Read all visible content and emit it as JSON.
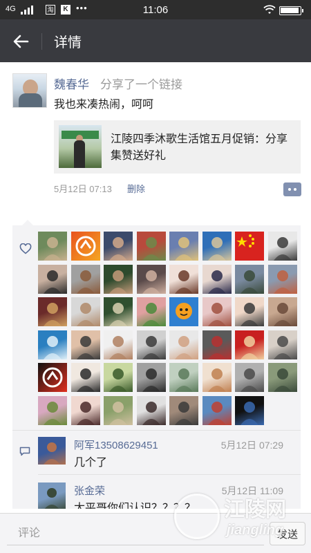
{
  "status_bar": {
    "network": "4G",
    "app_badge_1": "淘",
    "app_badge_2": "K",
    "more": "•••",
    "time": "11:06"
  },
  "header": {
    "title": "详情"
  },
  "post": {
    "author": "魏春华",
    "action": "分享了一个链接",
    "text": "我也来凑热闹，呵呵",
    "link_title": "江陵四季沐歌生活馆五月促销：分享集赞送好礼",
    "timestamp": "5月12日 07:13",
    "delete_label": "删除"
  },
  "likes": {
    "avatars": [
      {
        "icon": "avatar-photo",
        "colors": [
          "#6e8a5c",
          "#c9b18f"
        ]
      },
      {
        "icon": "avatar-logo",
        "colors": [
          "#e8531f",
          "#f5a623"
        ]
      },
      {
        "icon": "avatar-photo",
        "colors": [
          "#3b4a6b",
          "#d3a98a"
        ]
      },
      {
        "icon": "avatar-photo",
        "colors": [
          "#b84a3c",
          "#6c8a4a"
        ]
      },
      {
        "icon": "avatar-photo",
        "colors": [
          "#6a7fb0",
          "#e0c27a"
        ]
      },
      {
        "icon": "avatar-photo",
        "colors": [
          "#2f6fb8",
          "#d9c69a"
        ]
      },
      {
        "icon": "avatar-flag",
        "colors": [
          "#d8231f",
          "#ffde00"
        ]
      },
      {
        "icon": "avatar-photo",
        "colors": [
          "#e8e8e8",
          "#3a3a3a"
        ]
      },
      {
        "icon": "avatar-photo",
        "colors": [
          "#c8b0a0",
          "#2a2a2a"
        ]
      },
      {
        "icon": "avatar-photo",
        "colors": [
          "#a0a0a0",
          "#8a5a3a"
        ]
      },
      {
        "icon": "avatar-photo",
        "colors": [
          "#2d4a2d",
          "#c49a7a"
        ]
      },
      {
        "icon": "avatar-photo",
        "colors": [
          "#5a4a4a",
          "#d0b0a0"
        ]
      },
      {
        "icon": "avatar-photo",
        "colors": [
          "#f0e0d8",
          "#6a3a2a"
        ]
      },
      {
        "icon": "avatar-photo",
        "colors": [
          "#e8d8d0",
          "#2a2a4a"
        ]
      },
      {
        "icon": "avatar-photo",
        "colors": [
          "#7a8aa0",
          "#3a4a3a"
        ]
      },
      {
        "icon": "avatar-photo",
        "colors": [
          "#8a9ab0",
          "#c06040"
        ]
      },
      {
        "icon": "avatar-photo",
        "colors": [
          "#6a2a2a",
          "#d0a060"
        ]
      },
      {
        "icon": "avatar-photo",
        "colors": [
          "#d8d8d8",
          "#b08a6a"
        ]
      },
      {
        "icon": "avatar-photo",
        "colors": [
          "#2f4f2f",
          "#d8d0b0"
        ]
      },
      {
        "icon": "avatar-photo",
        "colors": [
          "#e0a0a0",
          "#4a8a3a"
        ]
      },
      {
        "icon": "avatar-cartoon",
        "colors": [
          "#f5a020",
          "#2f7fd0"
        ]
      },
      {
        "icon": "avatar-photo",
        "colors": [
          "#e8c8c8",
          "#a05040"
        ]
      },
      {
        "icon": "avatar-photo",
        "colors": [
          "#f0d8c8",
          "#3a3a3a"
        ]
      },
      {
        "icon": "avatar-photo",
        "colors": [
          "#c8a890",
          "#6a4a3a"
        ]
      },
      {
        "icon": "avatar-photo",
        "colors": [
          "#2a7fc0",
          "#e0f0f8"
        ]
      },
      {
        "icon": "avatar-photo",
        "colors": [
          "#e0c0a8",
          "#3a3a3a"
        ]
      },
      {
        "icon": "avatar-photo",
        "colors": [
          "#f0f0f0",
          "#b08060"
        ]
      },
      {
        "icon": "avatar-photo",
        "colors": [
          "#d0d0d0",
          "#3a3a3a"
        ]
      },
      {
        "icon": "avatar-photo",
        "colors": [
          "#e8e8e8",
          "#d0a080"
        ]
      },
      {
        "icon": "avatar-photo",
        "colors": [
          "#5a5a5a",
          "#b83030"
        ]
      },
      {
        "icon": "avatar-photo",
        "colors": [
          "#c82020",
          "#f0d0a0"
        ]
      },
      {
        "icon": "avatar-photo",
        "colors": [
          "#d8d0c8",
          "#4a4a4a"
        ]
      },
      {
        "icon": "avatar-logo",
        "colors": [
          "#111111",
          "#e03020"
        ]
      },
      {
        "icon": "avatar-photo",
        "colors": [
          "#f0e8e0",
          "#2a2a2a"
        ]
      },
      {
        "icon": "avatar-photo",
        "colors": [
          "#c8d8a0",
          "#3a5a2a"
        ]
      },
      {
        "icon": "avatar-photo",
        "colors": [
          "#a0a0a0",
          "#2a2a2a"
        ]
      },
      {
        "icon": "avatar-photo",
        "colors": [
          "#c0d0c0",
          "#5a7a5a"
        ]
      },
      {
        "icon": "avatar-photo",
        "colors": [
          "#f0e0d0",
          "#c08050"
        ]
      },
      {
        "icon": "avatar-photo",
        "colors": [
          "#b0b0b0",
          "#4a4a4a"
        ]
      },
      {
        "icon": "avatar-photo",
        "colors": [
          "#8a9a7a",
          "#3a4a3a"
        ]
      },
      {
        "icon": "avatar-photo",
        "colors": [
          "#d8a8c0",
          "#6a8a3a"
        ]
      },
      {
        "icon": "avatar-photo",
        "colors": [
          "#f0d8d0",
          "#4a2a2a"
        ]
      },
      {
        "icon": "avatar-photo",
        "colors": [
          "#8aa06a",
          "#d0c0a0"
        ]
      },
      {
        "icon": "avatar-photo",
        "colors": [
          "#e0e0e0",
          "#3a2a2a"
        ]
      },
      {
        "icon": "avatar-photo",
        "colors": [
          "#a08a7a",
          "#3a3a3a"
        ]
      },
      {
        "icon": "avatar-photo",
        "colors": [
          "#5a8ac0",
          "#c04030"
        ]
      },
      {
        "icon": "avatar-photo",
        "colors": [
          "#111111",
          "#3a6ab0"
        ]
      }
    ]
  },
  "comments": [
    {
      "author": "阿军13508629451",
      "time": "5月12日 07:29",
      "text": "几个了",
      "colors": [
        "#3a5a9a",
        "#b07050"
      ]
    },
    {
      "author": "张金荣",
      "time": "5月12日 11:09",
      "text": "太平哥你们认识？？？？",
      "colors": [
        "#7a9ac0",
        "#3a4a3a"
      ]
    }
  ],
  "input_bar": {
    "placeholder": "评论",
    "send_label": "发送"
  },
  "watermark": {
    "title": "江陵网",
    "subtitle": "jiangling"
  },
  "colors": {
    "header_bg": "#393a3f",
    "status_bg": "#2d2d2d",
    "name_blue": "#576b95",
    "panel_bg": "#f3f3f5"
  }
}
